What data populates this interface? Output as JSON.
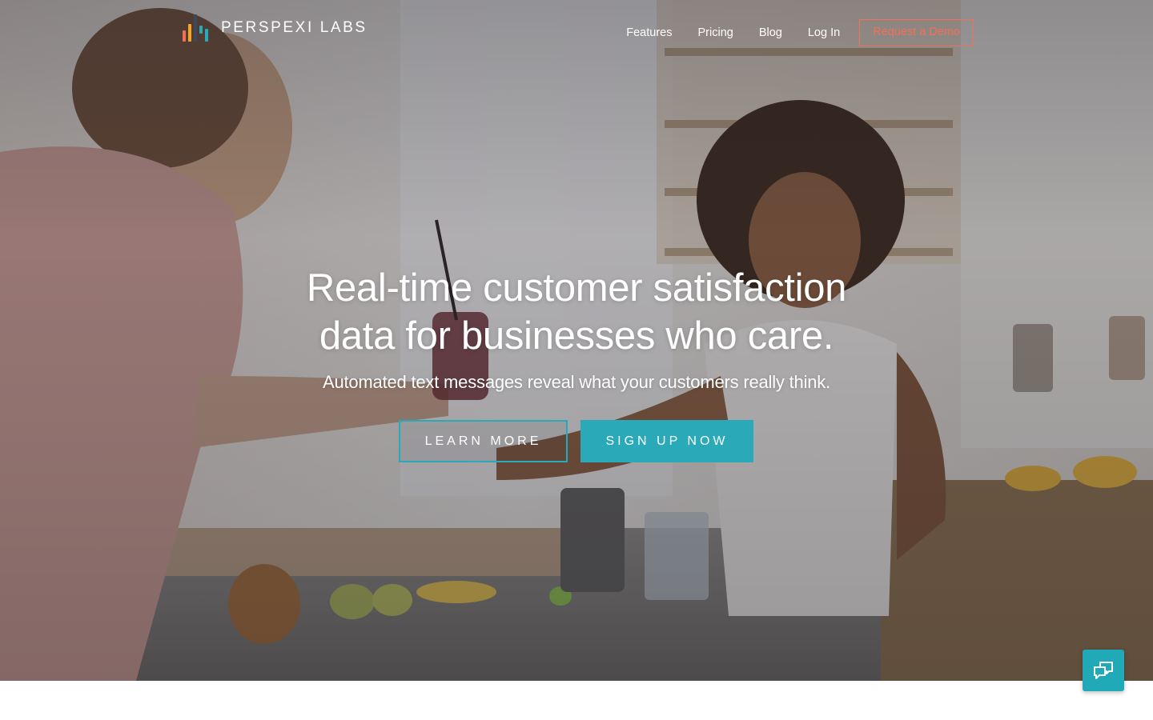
{
  "brand": {
    "name": "PERSPEXI LABS",
    "logo_bar_colors": [
      "#f0705a",
      "#f5a623",
      "#3a4a5c",
      "#2aa9b8"
    ],
    "accent_color": "#2aa9b8",
    "cta_outline_color": "#f0705a"
  },
  "nav": {
    "items": [
      {
        "label": "Features"
      },
      {
        "label": "Pricing"
      },
      {
        "label": "Blog"
      },
      {
        "label": "Log In"
      }
    ],
    "cta_label": "Request a Demo"
  },
  "hero": {
    "headline_line1": "Real-time customer satisfaction",
    "headline_line2": "data for businesses who care.",
    "subheadline": "Automated text messages reveal what your customers really think.",
    "learn_more_label": "LEARN MORE",
    "sign_up_label": "SIGN UP NOW",
    "background_image": "cafe-counter-photo"
  },
  "chat_widget": {
    "icon": "chat-bubbles-icon"
  }
}
